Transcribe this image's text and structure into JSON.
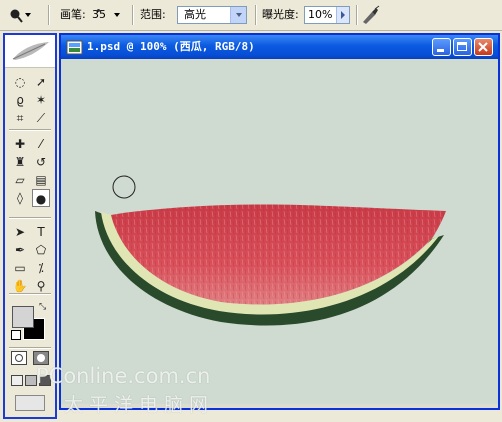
{
  "options_bar": {
    "tool_icon": "dodge-tool-icon",
    "brush_label": "画笔:",
    "brush_size": "35",
    "range_label": "范围:",
    "range_value": "高光",
    "exposure_label": "曝光度:",
    "exposure_value": "10%",
    "airbrush_icon": "airbrush-icon"
  },
  "document": {
    "title": "1.psd @ 100% (西瓜, RGB/8)",
    "canvas_color": "#cfdad0"
  },
  "toolbox": {
    "header_icon": "feather-logo-icon",
    "tools": [
      "marquee-icon",
      "move-icon",
      "lasso-icon",
      "magic-wand-icon",
      "crop-icon",
      "slice-icon",
      "healing-brush-icon",
      "brush-icon",
      "clone-stamp-icon",
      "history-brush-icon",
      "eraser-icon",
      "gradient-icon",
      "blur-icon",
      "dodge-icon",
      "path-select-icon",
      "type-icon",
      "pen-icon",
      "shape-icon",
      "notes-icon",
      "eyedropper-icon",
      "hand-icon",
      "zoom-icon"
    ],
    "foreground_color": "#d4d4d4",
    "background_color": "#000000"
  },
  "watermark": {
    "line1": "PConline.com.cn",
    "line2": "太平洋电脑网"
  },
  "colors": {
    "titlebar": "#0b5ae0",
    "toolbox_border": "#1c3bd6",
    "watermelon_flesh": "#d2434f",
    "watermelon_rind": "#2a4a2c"
  }
}
